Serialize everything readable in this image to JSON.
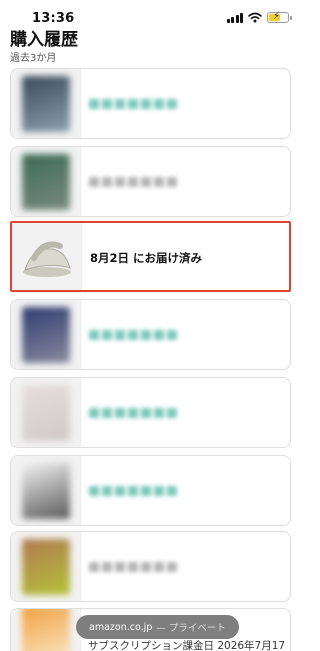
{
  "status": {
    "time": "13:36"
  },
  "header": {
    "title": "購入履歴",
    "subtitle": "過去3か月"
  },
  "orders": [
    {
      "thumb_colors": [
        "#3a4a5a",
        "#8aa0b0"
      ],
      "text_color": "#7cc8bb",
      "label": ""
    },
    {
      "thumb_colors": [
        "#3c6b55",
        "#7a8a82"
      ],
      "text_color": "#b5b5b5",
      "label": ""
    },
    {
      "thumb_colors": [
        "#d8d8cc",
        "#a9a99c"
      ],
      "text_color": "",
      "label": "8月2日 にお届け済み"
    },
    {
      "thumb_colors": [
        "#2e3c6e",
        "#8a8aa0"
      ],
      "text_color": "#7cc8bb",
      "label": ""
    },
    {
      "thumb_colors": [
        "#e6dede",
        "#cfc9c9"
      ],
      "text_color": "#7cc8bb",
      "label": ""
    },
    {
      "thumb_colors": [
        "#f3f3f3",
        "#5a5a5a"
      ],
      "text_color": "#7cc8bb",
      "label": ""
    },
    {
      "thumb_colors": [
        "#b07a50",
        "#b5c23a"
      ],
      "text_color": "#b5b5b5",
      "label": ""
    },
    {
      "thumb_colors": [
        "#f0a040",
        "#fbe8c8"
      ],
      "text_color": "",
      "label": ""
    }
  ],
  "toast": {
    "domain": "amazon.co.jp",
    "note": "— プライベート"
  },
  "subscription": {
    "text": "サブスクリプション課金日 2026年7月17"
  },
  "colors": {
    "highlight_border": "#e0442f",
    "battery": "#f4cf2a"
  }
}
